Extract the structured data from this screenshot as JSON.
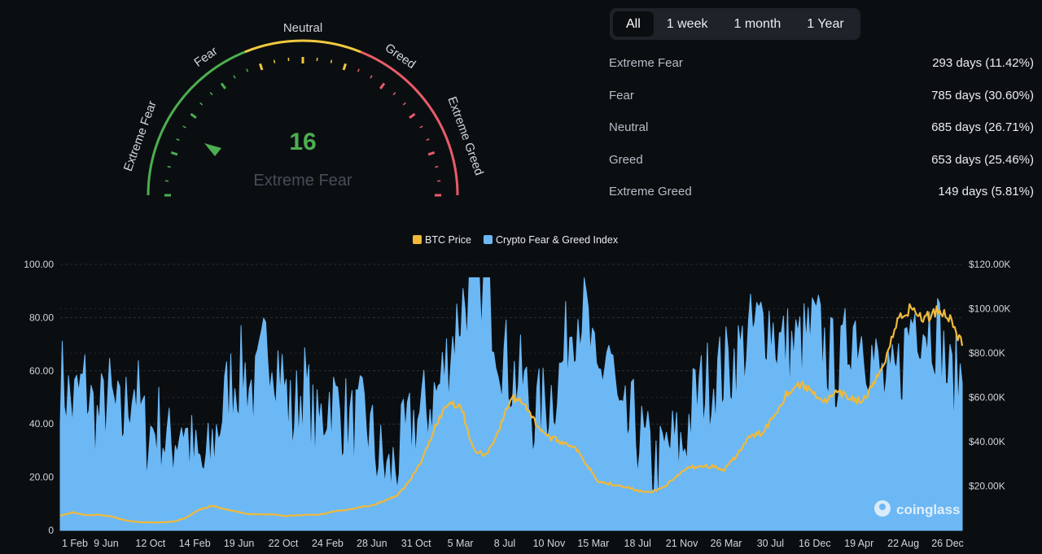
{
  "gauge": {
    "value": "16",
    "status": "Extreme Fear",
    "labels": [
      "Extreme Fear",
      "Fear",
      "Neutral",
      "Greed",
      "Extreme Greed"
    ],
    "colors": {
      "fear": "#4caf50",
      "neutral": "#f0c93f",
      "greed": "#e85c6a",
      "value": "#4caf50"
    }
  },
  "tabs": [
    "All",
    "1 week",
    "1 month",
    "1 Year"
  ],
  "active_tab": "All",
  "stats": [
    {
      "label": "Extreme Fear",
      "value": "293 days (11.42%)"
    },
    {
      "label": "Fear",
      "value": "785 days (30.60%)"
    },
    {
      "label": "Neutral",
      "value": "685 days (26.71%)"
    },
    {
      "label": "Greed",
      "value": "653 days (25.46%)"
    },
    {
      "label": "Extreme Greed",
      "value": "149 days (5.81%)"
    }
  ],
  "watermark": "coinglass",
  "chart_data": {
    "type": "area",
    "legend": [
      "BTC Price",
      "Crypto Fear & Greed Index"
    ],
    "colors": {
      "btc": "#f0b93a",
      "index": "#6cb8f5"
    },
    "x_ticks": [
      "1 Feb",
      "9 Jun",
      "12 Oct",
      "14 Feb",
      "19 Jun",
      "22 Oct",
      "24 Feb",
      "28 Jun",
      "31 Oct",
      "5 Mar",
      "8 Jul",
      "10 Nov",
      "15 Mar",
      "18 Jul",
      "21 Nov",
      "26 Mar",
      "30 Jul",
      "16 Dec",
      "19 Apr",
      "22 Aug",
      "26 Dec"
    ],
    "y_left_ticks": [
      "100.00",
      "80.00",
      "60.00",
      "40.00",
      "20.00",
      "0"
    ],
    "y_left_range": [
      0,
      100
    ],
    "y_right_ticks": [
      "$120.00K",
      "$100.00K",
      "$80.00K",
      "$60.00K",
      "$40.00K",
      "$20.00K"
    ],
    "y_right_range": [
      0,
      120000
    ],
    "index_values": [
      58,
      46,
      55,
      40,
      50,
      38,
      57,
      35,
      40,
      30,
      42,
      25,
      22,
      40,
      55,
      60,
      50,
      72,
      62,
      40,
      55,
      35,
      50,
      45,
      38,
      42,
      28,
      20,
      30,
      40,
      45,
      52,
      68,
      85,
      90,
      93,
      70,
      58,
      55,
      42,
      48,
      58,
      80,
      85,
      52,
      70,
      35,
      40,
      30,
      22,
      32,
      30,
      48,
      55,
      58,
      62,
      68,
      75,
      80,
      70,
      68,
      70,
      76,
      65,
      60,
      78,
      72,
      60,
      50,
      62,
      82,
      78,
      75,
      55,
      58
    ],
    "btc_values": [
      6500,
      8200,
      6800,
      7000,
      6400,
      4800,
      3800,
      3600,
      3600,
      4000,
      5500,
      9000,
      11000,
      10000,
      8500,
      7500,
      7200,
      7300,
      6500,
      6800,
      7000,
      7300,
      8800,
      9200,
      10500,
      11500,
      13500,
      16500,
      23000,
      33000,
      48000,
      58000,
      56000,
      36000,
      34000,
      45000,
      60000,
      58000,
      48000,
      42000,
      40000,
      38000,
      30000,
      22000,
      21000,
      20000,
      18000,
      17000,
      19000,
      23000,
      28000,
      29000,
      29000,
      27000,
      34000,
      42000,
      44000,
      52000,
      62000,
      66000,
      63000,
      58000,
      62000,
      60000,
      58000,
      66000,
      80000,
      97000,
      100000,
      95000,
      100000,
      96000,
      84000
    ]
  }
}
